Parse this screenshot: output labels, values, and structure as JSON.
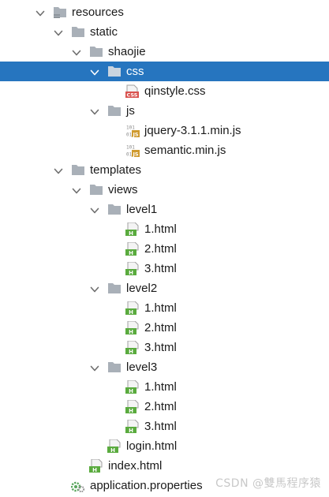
{
  "tree": {
    "nodes": [
      {
        "label": "resources",
        "depth": 0,
        "kind": "folder",
        "expanded": true,
        "resourceRoot": true
      },
      {
        "label": "static",
        "depth": 1,
        "kind": "folder",
        "expanded": true
      },
      {
        "label": "shaojie",
        "depth": 2,
        "kind": "folder",
        "expanded": true
      },
      {
        "label": "css",
        "depth": 3,
        "kind": "folder",
        "expanded": true,
        "selected": true
      },
      {
        "label": "qinstyle.css",
        "depth": 4,
        "kind": "css"
      },
      {
        "label": "js",
        "depth": 3,
        "kind": "folder",
        "expanded": true
      },
      {
        "label": "jquery-3.1.1.min.js",
        "depth": 4,
        "kind": "js"
      },
      {
        "label": "semantic.min.js",
        "depth": 4,
        "kind": "js"
      },
      {
        "label": "templates",
        "depth": 1,
        "kind": "folder",
        "expanded": true
      },
      {
        "label": "views",
        "depth": 2,
        "kind": "folder",
        "expanded": true
      },
      {
        "label": "level1",
        "depth": 3,
        "kind": "folder",
        "expanded": true
      },
      {
        "label": "1.html",
        "depth": 4,
        "kind": "html"
      },
      {
        "label": "2.html",
        "depth": 4,
        "kind": "html"
      },
      {
        "label": "3.html",
        "depth": 4,
        "kind": "html"
      },
      {
        "label": "level2",
        "depth": 3,
        "kind": "folder",
        "expanded": true
      },
      {
        "label": "1.html",
        "depth": 4,
        "kind": "html"
      },
      {
        "label": "2.html",
        "depth": 4,
        "kind": "html"
      },
      {
        "label": "3.html",
        "depth": 4,
        "kind": "html"
      },
      {
        "label": "level3",
        "depth": 3,
        "kind": "folder",
        "expanded": true
      },
      {
        "label": "1.html",
        "depth": 4,
        "kind": "html"
      },
      {
        "label": "2.html",
        "depth": 4,
        "kind": "html"
      },
      {
        "label": "3.html",
        "depth": 4,
        "kind": "html"
      },
      {
        "label": "login.html",
        "depth": 3,
        "kind": "html"
      },
      {
        "label": "index.html",
        "depth": 2,
        "kind": "html"
      },
      {
        "label": "application.properties",
        "depth": 1,
        "kind": "properties"
      }
    ]
  },
  "watermark": "CSDN @雙馬程序猿",
  "icons": {
    "folder": "folder-icon",
    "css": "css-file-icon",
    "js": "js-file-icon",
    "html": "html-file-icon",
    "properties": "properties-file-icon",
    "chevron_open": "chevron-down-icon"
  },
  "colors": {
    "selection": "#2675bf",
    "folder": "#a9b0b8",
    "css_badge": "#d9534f",
    "js_badge": "#cf9a2f",
    "html_badge": "#5aab3e",
    "properties_gear": "#58a55c"
  }
}
